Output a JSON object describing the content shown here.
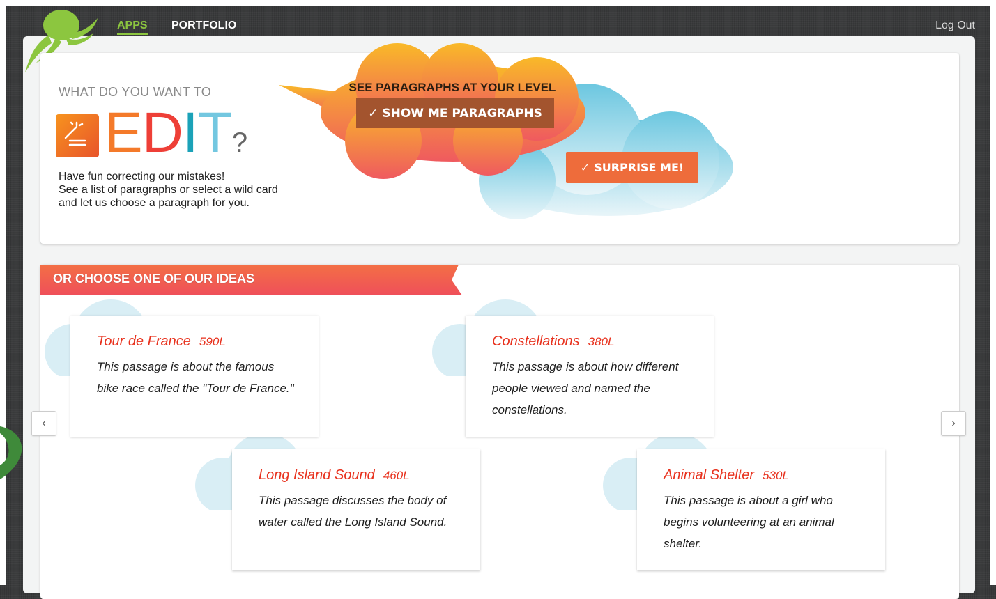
{
  "nav": {
    "apps": "APPS",
    "portfolio": "PORTFOLIO",
    "logout": "Log Out"
  },
  "hero": {
    "eyebrow": "WHAT DO YOU WANT TO",
    "word_letters": [
      "E",
      "D",
      "I",
      "T"
    ],
    "word_qmark": "?",
    "desc_line1": "Have fun correcting our mistakes!",
    "desc_line2": "See a list of paragraphs or select a wild card",
    "desc_line3": "and let us choose a paragraph for you.",
    "cloud_title": "SEE PARAGRAPHS AT YOUR LEVEL",
    "show_button": "SHOW ME PARAGRAPHS",
    "surprise_button": "SURPRISE ME!"
  },
  "ideas": {
    "ribbon": "OR CHOOSE ONE OF OUR IDEAS",
    "prev": "‹",
    "next": "›",
    "cards": [
      {
        "title": "Tour de France",
        "level": "590L",
        "desc": "This passage is about the famous bike race called the \"Tour de France.\""
      },
      {
        "title": "Constellations",
        "level": "380L",
        "desc": "This passage is about how different people viewed and named the constellations."
      },
      {
        "title": "Long Island Sound",
        "level": "460L",
        "desc": "This passage discusses the body of water called the Long Island Sound."
      },
      {
        "title": "Animal Shelter",
        "level": "530L",
        "desc": "This passage is about a girl who begins volunteering at an animal shelter."
      }
    ]
  },
  "colors": {
    "brand_green": "#8cc63f",
    "accent_orange": "#ee6c3b",
    "title_red": "#e8321e",
    "sky_blue": "#7fcce0"
  }
}
